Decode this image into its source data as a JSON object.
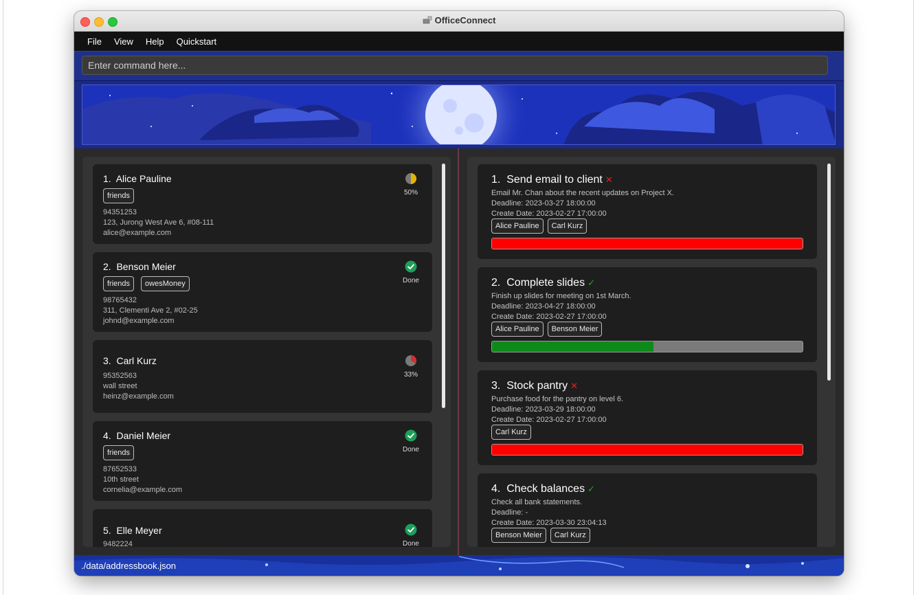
{
  "window": {
    "title": "OfficeConnect"
  },
  "menu": [
    "File",
    "View",
    "Help",
    "Quickstart"
  ],
  "command": {
    "placeholder": "Enter command here...",
    "value": ""
  },
  "persons": [
    {
      "index": "1.",
      "name": "Alice Pauline",
      "tags": [
        "friends"
      ],
      "phone": "94351253",
      "address": "123, Jurong West Ave 6, #08-111",
      "email": "alice@example.com",
      "status": "50%",
      "progress": 0.5
    },
    {
      "index": "2.",
      "name": "Benson Meier",
      "tags": [
        "friends",
        "owesMoney"
      ],
      "phone": "98765432",
      "address": "311, Clementi Ave 2, #02-25",
      "email": "johnd@example.com",
      "status": "Done",
      "progress": 1.0
    },
    {
      "index": "3.",
      "name": "Carl Kurz",
      "tags": [],
      "phone": "95352563",
      "address": "wall street",
      "email": "heinz@example.com",
      "status": "33%",
      "progress": 0.33
    },
    {
      "index": "4.",
      "name": "Daniel Meier",
      "tags": [
        "friends"
      ],
      "phone": "87652533",
      "address": "10th street",
      "email": "cornelia@example.com",
      "status": "Done",
      "progress": 1.0
    },
    {
      "index": "5.",
      "name": "Elle Meyer",
      "tags": [],
      "phone": "9482224",
      "address": "",
      "email": "",
      "status": "Done",
      "progress": 1.0
    }
  ],
  "tasks": [
    {
      "index": "1.",
      "title": "Send email to client",
      "done_mark": "✕",
      "done": false,
      "description": "Email Mr. Chan about the recent updates on Project X.",
      "deadline": "Deadline: 2023-03-27 18:00:00",
      "created": "Create Date: 2023-02-27 17:00:00",
      "assignees": [
        "Alice Pauline",
        "Carl Kurz"
      ],
      "progress": 1.0,
      "progress_color": "#ff0000"
    },
    {
      "index": "2.",
      "title": "Complete slides",
      "done_mark": "✓",
      "done": true,
      "description": "Finish up slides for meeting on 1st March.",
      "deadline": "Deadline: 2023-04-27 18:00:00",
      "created": "Create Date: 2023-02-27 17:00:00",
      "assignees": [
        "Alice Pauline",
        "Benson Meier"
      ],
      "progress": 0.52,
      "progress_color": "#0e8a1a"
    },
    {
      "index": "3.",
      "title": "Stock pantry",
      "done_mark": "✕",
      "done": false,
      "description": "Purchase food for the pantry on level 6.",
      "deadline": "Deadline: 2023-03-29 18:00:00",
      "created": "Create Date: 2023-02-27 17:00:00",
      "assignees": [
        "Carl Kurz"
      ],
      "progress": 1.0,
      "progress_color": "#ff0000"
    },
    {
      "index": "4.",
      "title": "Check balances",
      "done_mark": "✓",
      "done": true,
      "description": "Check all bank statements.",
      "deadline": "Deadline: -",
      "created": "Create Date: 2023-03-30 23:04:13",
      "assignees": [
        "Benson Meier",
        "Carl Kurz"
      ],
      "progress": null,
      "progress_color": ""
    }
  ],
  "statusbar": {
    "path": "./data/addressbook.json"
  },
  "colors": {
    "accent_blue": "#1f2f8c",
    "done_green": "#1e9e5a",
    "pie_yellow": "#e6b400",
    "pie_red": "#d03030"
  }
}
